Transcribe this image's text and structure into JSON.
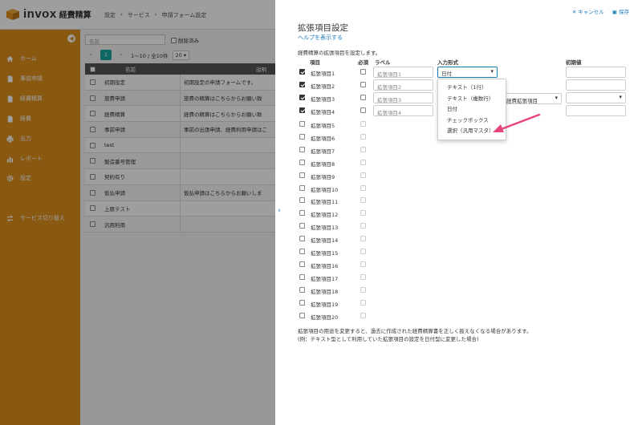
{
  "app": {
    "name": "invox",
    "product": "経費精算"
  },
  "breadcrumb": [
    "設定",
    "›",
    "サービス",
    "›",
    "申請フォーム設定"
  ],
  "sidebar": {
    "items": [
      {
        "label": "ホーム",
        "icon": "home-icon"
      },
      {
        "label": "事前申請",
        "icon": "document-icon"
      },
      {
        "label": "経費精算",
        "icon": "document-icon"
      },
      {
        "label": "経費",
        "icon": "document-icon"
      },
      {
        "label": "出力",
        "icon": "printer-icon"
      },
      {
        "label": "レポート",
        "icon": "chart-icon"
      },
      {
        "label": "設定",
        "icon": "gear-icon"
      },
      {
        "label": "サービス切り替え",
        "icon": "switch-icon"
      }
    ]
  },
  "list": {
    "search_placeholder": "名前",
    "deleted_label": "削除済み",
    "page_current": "1",
    "page_range": "1〜10 / 全10件",
    "page_size": "20 ▾",
    "columns": {
      "name": "名前",
      "description": "説明"
    },
    "rows": [
      {
        "name": "初期設定",
        "desc": "初期設定の申請フォームです。"
      },
      {
        "name": "旅費申請",
        "desc": "旅費の精算はこちらからお願い致"
      },
      {
        "name": "経費精算",
        "desc": "経費の精算はこちらからお願い致"
      },
      {
        "name": "事前申請",
        "desc": "事前の出張申請、経費利用申請はこ"
      },
      {
        "name": "test",
        "desc": ""
      },
      {
        "name": "製造番号管理",
        "desc": ""
      },
      {
        "name": "契約有り",
        "desc": ""
      },
      {
        "name": "仮払申請",
        "desc": "仮払申請はこちらからお願いしま"
      },
      {
        "name": "上原テスト",
        "desc": ""
      },
      {
        "name": "汎用利用",
        "desc": ""
      }
    ]
  },
  "panel": {
    "cancel": "✕ キャンセル",
    "save": "保存",
    "title": "拡張項目設定",
    "help": "ヘルプを表示する",
    "intro": "経費精算の拡張項目を設定します。",
    "col_item": "項目",
    "col_required": "必須",
    "col_label": "ラベル",
    "col_type": "入力形式",
    "col_default": "初期値",
    "type_value": "日付",
    "master_value": "経費拡張項目",
    "dropdown": [
      "テキスト（1行）",
      "テキスト（複数行）",
      "日付",
      "チェックボックス",
      "選択（汎用マスタ）"
    ],
    "fields": [
      {
        "label": "拡張項目1",
        "checked": true,
        "input": "拡張項目1"
      },
      {
        "label": "拡張項目2",
        "checked": true,
        "input": "拡張項目2"
      },
      {
        "label": "拡張項目3",
        "checked": true,
        "input": "拡張項目3"
      },
      {
        "label": "拡張項目4",
        "checked": true,
        "input": "拡張項目4"
      },
      {
        "label": "拡張項目5",
        "checked": false
      },
      {
        "label": "拡張項目6",
        "checked": false
      },
      {
        "label": "拡張項目7",
        "checked": false
      },
      {
        "label": "拡張項目8",
        "checked": false
      },
      {
        "label": "拡張項目9",
        "checked": false
      },
      {
        "label": "拡張項目10",
        "checked": false
      },
      {
        "label": "拡張項目11",
        "checked": false
      },
      {
        "label": "拡張項目12",
        "checked": false
      },
      {
        "label": "拡張項目13",
        "checked": false
      },
      {
        "label": "拡張項目14",
        "checked": false
      },
      {
        "label": "拡張項目15",
        "checked": false
      },
      {
        "label": "拡張項目16",
        "checked": false
      },
      {
        "label": "拡張項目17",
        "checked": false
      },
      {
        "label": "拡張項目18",
        "checked": false
      },
      {
        "label": "拡張項目19",
        "checked": false
      },
      {
        "label": "拡張項目20",
        "checked": false
      }
    ],
    "note1": "拡張項目の用途を変更すると、過去に作成された経費精算書を正しく扱えなくなる場合があります。",
    "note2": "(例：テキスト型として利用していた拡張項目の設定を日付型に変更した場合)"
  },
  "colors": {
    "sidebar": "#dd8e1c",
    "accent": "#1a7bb8",
    "page_active": "#1aa6a0",
    "arrow": "#e8457a"
  }
}
